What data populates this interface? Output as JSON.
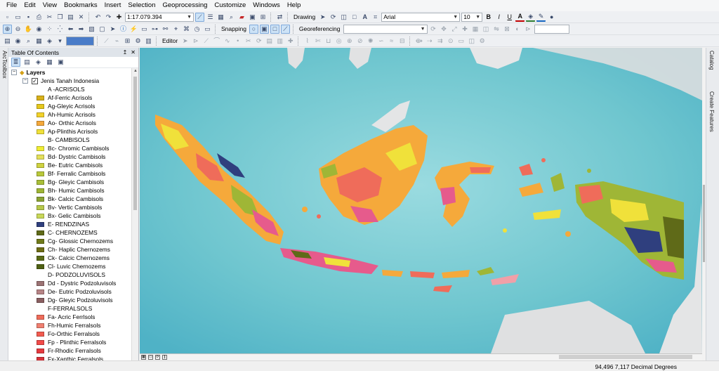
{
  "menu": [
    "File",
    "Edit",
    "View",
    "Bookmarks",
    "Insert",
    "Selection",
    "Geoprocessing",
    "Customize",
    "Windows",
    "Help"
  ],
  "toolbar": {
    "scale": "1:17.079.394",
    "drawing_label": "Drawing",
    "font_name": "Arial",
    "font_size": "10",
    "bold": "B",
    "italic": "I",
    "underline": "U",
    "font_color": "A",
    "text_tool": "A",
    "snapping_label": "Snapping",
    "georeferencing_label": "Georeferencing",
    "editor_label": "Editor",
    "colors": {
      "font": "#c00000",
      "fill": "#2e7d32",
      "line": "#1565c0"
    }
  },
  "side_tabs": {
    "left": "ArcToolbox",
    "right_top": "Catalog",
    "right_bottom": "Create Features"
  },
  "toc": {
    "title": "Table Of Contents",
    "pin": "↥",
    "close": "✕",
    "layers_label": "Layers",
    "layer_name": "Jenis Tanah Indonesia",
    "entries": [
      {
        "label": "A -ACRISOLS",
        "heading": true
      },
      {
        "label": "Af-Ferric Acrisols",
        "color": "#d8b11a"
      },
      {
        "label": "Ag-Gleyic Acrisols",
        "color": "#e6c81c"
      },
      {
        "label": "Ah-Humic Acrisols",
        "color": "#f2d22a"
      },
      {
        "label": "Ao- Orthic Acrisols",
        "color": "#f5a93b"
      },
      {
        "label": "Ap-Plinthis Acrisols",
        "color": "#f0e13a"
      },
      {
        "label": "B- CAMBISOLS",
        "heading": true
      },
      {
        "label": "Bc- Chromic Cambisols",
        "color": "#f0ee34"
      },
      {
        "label": "Bd- Dystric Cambisols",
        "color": "#e4e05a"
      },
      {
        "label": "Be- Eutric Cambisols",
        "color": "#cfd23f"
      },
      {
        "label": "Bf- Ferralic Cambisols",
        "color": "#b9c83a"
      },
      {
        "label": "Bg- Gleyic Cambisols",
        "color": "#a9bf38"
      },
      {
        "label": "Bh- Humic Cambisols",
        "color": "#9fb636"
      },
      {
        "label": "Bk- Calcic Cambisols",
        "color": "#8aa334"
      },
      {
        "label": "Bv- Vertic Cambisols",
        "color": "#b7c94a"
      },
      {
        "label": "Bx- Gelic Cambisols",
        "color": "#c9d858"
      },
      {
        "label": "E- RENDZINAS",
        "color": "#2f3f7e"
      },
      {
        "label": "C- CHERNOZEMS",
        "color": "#5f6a18"
      },
      {
        "label": "Cg- Glossic Chernozems",
        "color": "#707a1a"
      },
      {
        "label": "Ch- Haplic Chernozems",
        "color": "#6e6d14"
      },
      {
        "label": "Ck- Calcic Chernozems",
        "color": "#5a6b16"
      },
      {
        "label": "Cl- Luvic Chernozems",
        "color": "#4f6113"
      },
      {
        "label": "D- PODZOLUVISOLS",
        "heading": true
      },
      {
        "label": "Dd - Dystric Podzoluvisols",
        "color": "#9c7374"
      },
      {
        "label": "De- Eutric Podzoluvisols",
        "color": "#b78486"
      },
      {
        "label": "Dg- Gleyic Podzoluvisols",
        "color": "#8a5f61"
      },
      {
        "label": "F-FERRALSOLS",
        "heading": true
      },
      {
        "label": "Fa- Acric Ferrlsols",
        "color": "#ef6c5a"
      },
      {
        "label": "Fh-Humic Ferralsols",
        "color": "#f07f70"
      },
      {
        "label": "Fo-Orthic Ferralsols",
        "color": "#f25b4f"
      },
      {
        "label": "Fp - Plinthic Ferralsols",
        "color": "#f24a48"
      },
      {
        "label": "Fr-Rhodic Ferralsols",
        "color": "#e63a3f"
      },
      {
        "label": "Fx-Xanthic Ferralsols",
        "color": "#d8333a"
      }
    ]
  },
  "map": {
    "ocean_color": "#72c9d0",
    "land_colors": [
      "#f5a93b",
      "#f0e13a",
      "#ef6c5a",
      "#9fb636",
      "#2f3f7e",
      "#e65b8c",
      "#5f6a18"
    ]
  },
  "status": {
    "coordinates": "94,496  7,117 Decimal Degrees"
  }
}
